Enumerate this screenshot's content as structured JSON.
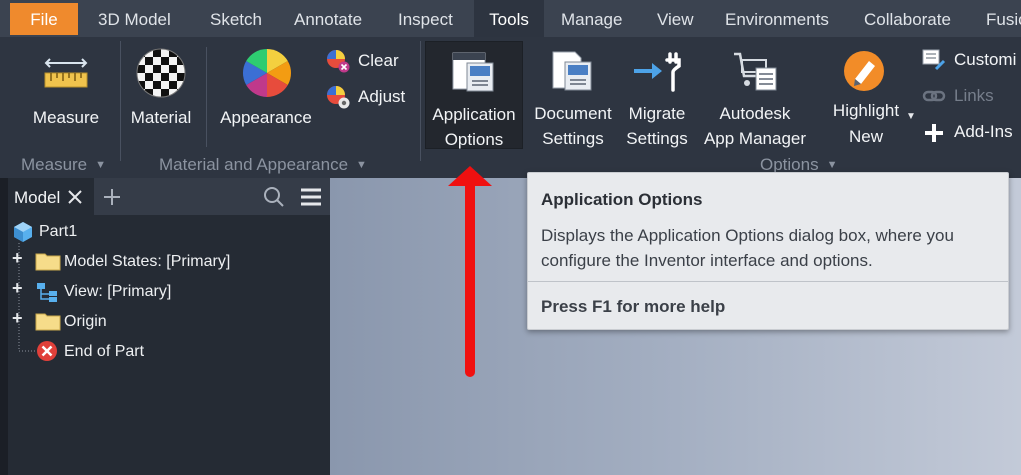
{
  "tabs": [
    "File",
    "3D Model",
    "Sketch",
    "Annotate",
    "Inspect",
    "Tools",
    "Manage",
    "View",
    "Environments",
    "Collaborate",
    "Fusio"
  ],
  "active_tab": "Tools",
  "ribbon": {
    "measure": {
      "label": "Measure",
      "panel": "Measure"
    },
    "material": {
      "label": "Material"
    },
    "appearance": {
      "label": "Appearance"
    },
    "clear": {
      "label": "Clear"
    },
    "adjust": {
      "label": "Adjust"
    },
    "material_panel": "Material and Appearance",
    "app_options": {
      "line1": "Application",
      "line2": "Options"
    },
    "doc_settings": {
      "line1": "Document",
      "line2": "Settings"
    },
    "migrate": {
      "line1": "Migrate",
      "line2": "Settings"
    },
    "app_manager": {
      "line1": "Autodesk",
      "line2": "App Manager"
    },
    "highlight": {
      "line1": "Highlight",
      "line2": "New"
    },
    "customize": {
      "label": "Customi"
    },
    "links": {
      "label": "Links"
    },
    "addins": {
      "label": "Add-Ins"
    },
    "options_panel": "Options"
  },
  "browser": {
    "tab_label": "Model",
    "tree": [
      {
        "label": "Part1"
      },
      {
        "label": "Model States: [Primary]"
      },
      {
        "label": "View: [Primary]"
      },
      {
        "label": "Origin"
      },
      {
        "label": "End of Part"
      }
    ]
  },
  "tooltip": {
    "title": "Application Options",
    "desc_line1": "Displays the Application Options dialog box, where you",
    "desc_line2": "configure the Inventor interface and options.",
    "help": "Press F1 for more help"
  },
  "colors": {
    "file_tab": "#ef8a2d",
    "annotation_arrow": "#f01010",
    "viewport_left": "#8a97ad",
    "viewport_right": "#c3cad8"
  }
}
